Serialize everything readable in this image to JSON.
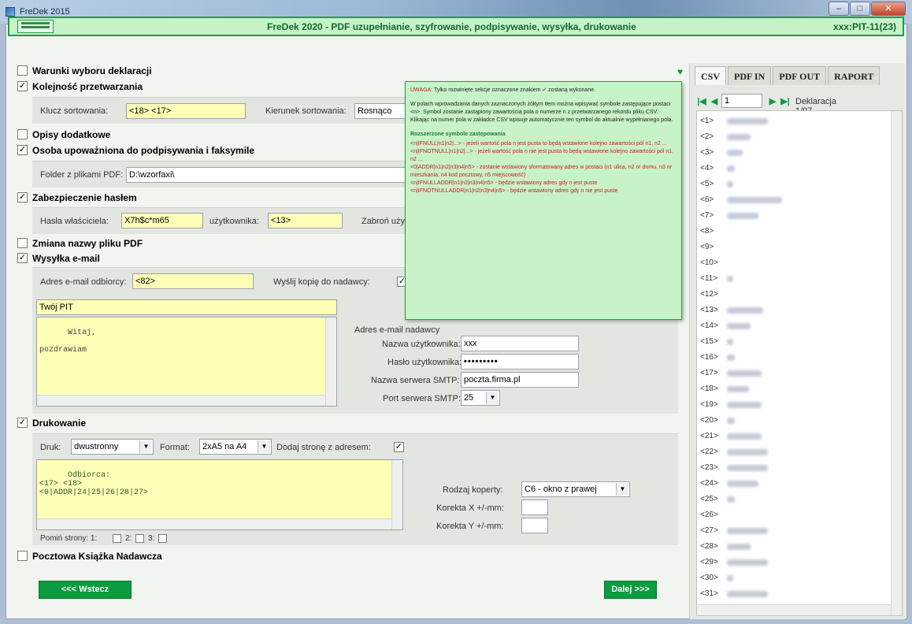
{
  "window": {
    "title": "FreDek 2015",
    "minimize": "–",
    "maximize": "□",
    "close": "✕"
  },
  "header": {
    "title": "FreDek 2020 - PDF uzupełnianie, szyfrowanie, podpisywanie, wysyłka, drukowanie",
    "right": "xxx:PIT-11(23)"
  },
  "sections": {
    "warunki": {
      "label": "Warunki wyboru deklaracji",
      "checked": false
    },
    "kolejnosc": {
      "label": "Kolejność przetwarzania",
      "checked": true,
      "klucz_label": "Klucz sortowania:",
      "klucz_value": "<18> <17>",
      "kierunek_label": "Kierunek sortowania:",
      "kierunek_value": "Rosnąco"
    },
    "opisy": {
      "label": "Opisy dodatkowe",
      "checked": false
    },
    "osoba": {
      "label": "Osoba upoważniona do podpisywania i faksymile",
      "checked": true,
      "folder_label": "Folder z plikami PDF:",
      "folder_value": "D:\\wzorfaxi\\"
    },
    "zabezpieczenie": {
      "label": "Zabezpieczenie hasłem",
      "checked": true,
      "wlasciciela_label": "Hasła właściciela:",
      "wlasciciela_value": "X7h$c*m65",
      "uzytkownika_label": "użytkownika:",
      "uzytkownika_value": "<13>",
      "zabron_label": "Zabroń użytk"
    },
    "zmiana": {
      "label": "Zmiana nazwy pliku PDF",
      "checked": false
    },
    "wysylka": {
      "label": "Wysyłka e-mail",
      "checked": true,
      "adres_label": "Adres e-mail odbiorcy:",
      "adres_value": "<82>",
      "kopia_label": "Wyślij kopię do nadawcy:",
      "kopia_checked": true,
      "subject_value": "Twój PIT",
      "body_value": "Witaj,\n\npozdrawiam",
      "nadawcy_label": "Adres e-mail nadawcy",
      "nazwa_label": "Nazwa użytkownika:",
      "nazwa_value": "xxx",
      "haslo_label": "Hasło użytkownika:",
      "haslo_value": "•••••••••",
      "serwer_label": "Nazwa serwera SMTP:",
      "serwer_value": "poczta.firma.pl",
      "port_label": "Port serwera SMTP:",
      "port_value": "25"
    },
    "drukowanie": {
      "label": "Drukowanie",
      "checked": true,
      "druk_label": "Druk:",
      "druk_value": "dwustronny",
      "format_label": "Format:",
      "format_value": "2xA5 na A4",
      "dodaj_label": "Dodaj stronę z adresem:",
      "dodaj_checked": true,
      "address_value": "Odbiorca:\n<17> <18>\n<0|ADDR|24|25|26|28|27>",
      "koperty_label": "Rodzaj koperty:",
      "koperty_value": "C6 - okno z prawej",
      "korekta_x_label": "Korekta X +/-mm:",
      "korekta_y_label": "Korekta Y +/-mm:",
      "pomin_label": "Pomiń strony: 1:",
      "pomin_2": "2:",
      "pomin_3": "3:"
    },
    "pocztowa": {
      "label": "Pocztowa Książka Nadawcza",
      "checked": false
    }
  },
  "buttons": {
    "back": "<<< Wstecz",
    "next": "Dalej >>>"
  },
  "tooltip": {
    "uwaga": "UWAGA:",
    "uwaga_text": "Tylko rozwinięte sekcje oznaczone znakiem ✓ zostaną wykonane.",
    "para1": "W polach wprowadzania danych zaznaczonych żółtym tłem można wpisywać symbole zastępujące postaci <n>. Symbol zostanie zastąpiony zawartością pola o numerze n z przetwarzanego rekordu pliku CSV. Klikając na numer pola w zakładce CSV wpisuje automatycznie ten symbol do aktualnie wypełnianego pola.",
    "heading": "Rozszerzone symbole zastępowania",
    "items": [
      "<n|IFNULL|n1|n2|...> - jeżeli wartość pola n jest pusta to będą wstawione kolejno zawartości pól n1, n2 ...",
      "<n|IFNOTNULL|n1|n2|...> - jeżeli wartość pola n nie jest pusta to będą wstawione kolejno zawartości pól n1, n2 ...",
      "<0|ADDR|n1|n2|n3|n4|n5> - zostanie wstawiony sformatowany adres w postaci (n1 ulica, n2 nr domu, n3 nr mieszkania, n4 kod pocztowy, n5 miejscowość)",
      "<n|IFNULLADDR|n1|n2|n3|n4|n5> - będzie wstawiony adres gdy n jest puste",
      "<n|IFNOTNULLADDR|n1|n2|n3|n4|n5> - będzie wstawiony adres gdy n nie jest puste"
    ]
  },
  "right": {
    "tabs": [
      "CSV",
      "PDF IN",
      "PDF OUT",
      "RAPORT"
    ],
    "page_value": "1",
    "deklaracja": "Deklaracja 1/97",
    "fields": [
      "<1>",
      "<2>",
      "<3>",
      "<4>",
      "<5>",
      "<6>",
      "<7>",
      "<8>",
      "<9>",
      "<10>",
      "<11>",
      "<12>",
      "<13>",
      "<14>",
      "<15>",
      "<16>",
      "<17>",
      "<18>",
      "<19>",
      "<20>",
      "<21>",
      "<22>",
      "<23>",
      "<24>",
      "<25>",
      "<26>",
      "<27>",
      "<28>",
      "<29>",
      "<30>",
      "<31>"
    ]
  },
  "colors": {
    "accent": "#0c9b3e",
    "yellow_field": "#ffffb8",
    "header_bg": "#c7f2c7"
  }
}
